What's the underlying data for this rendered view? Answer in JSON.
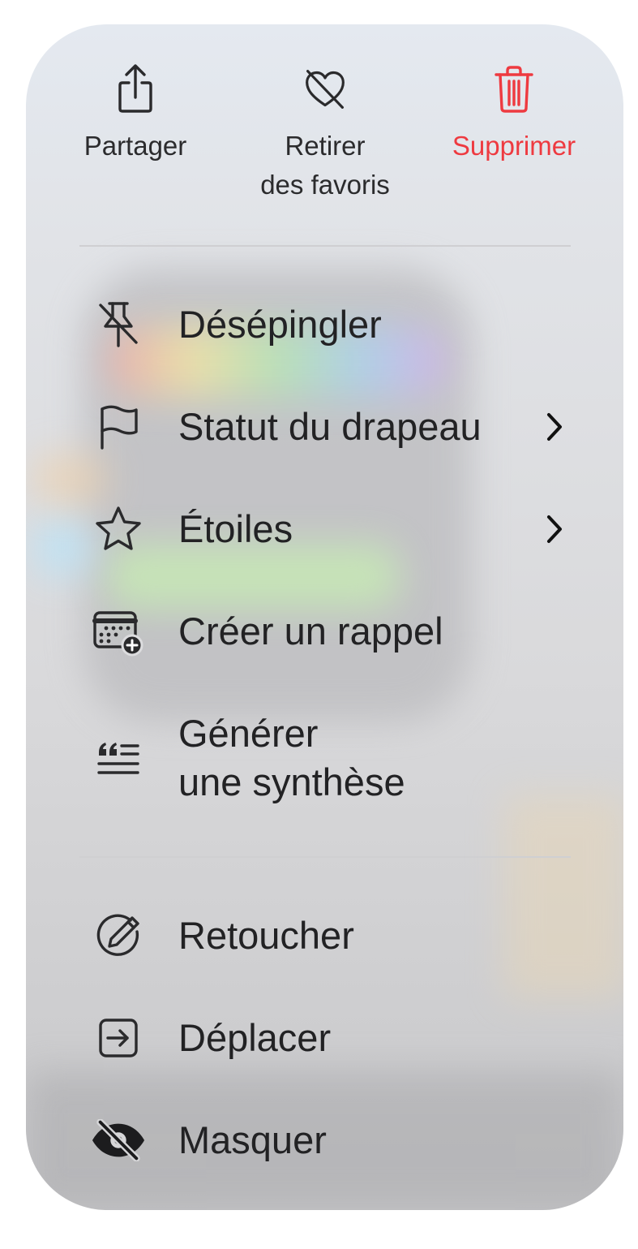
{
  "top_actions": {
    "share": {
      "label": "Partager",
      "icon": "share-icon"
    },
    "unfavorite": {
      "label": "Retirer\ndes favoris",
      "icon": "heart-slash-icon"
    },
    "delete": {
      "label": "Supprimer",
      "icon": "trash-icon",
      "color": "#ee3a40"
    }
  },
  "menu_items": [
    {
      "label": "Désépingler",
      "icon": "pin-slash-icon"
    },
    {
      "label": "Statut du drapeau",
      "icon": "flag-icon",
      "submenu": true
    },
    {
      "label": "Étoiles",
      "icon": "star-icon",
      "submenu": true
    },
    {
      "label": "Créer un rappel",
      "icon": "calendar-plus-icon"
    },
    {
      "label": "Générer\nune synthèse",
      "icon": "quote-lines-icon"
    },
    {
      "label": "Retoucher",
      "icon": "pencil-slash-circle-icon"
    },
    {
      "label": "Déplacer",
      "icon": "move-icon"
    },
    {
      "label": "Masquer",
      "icon": "eye-slash-icon"
    }
  ],
  "colors": {
    "text": "#222224",
    "destructive": "#ee3a40",
    "divider": "#cfcfd2"
  }
}
